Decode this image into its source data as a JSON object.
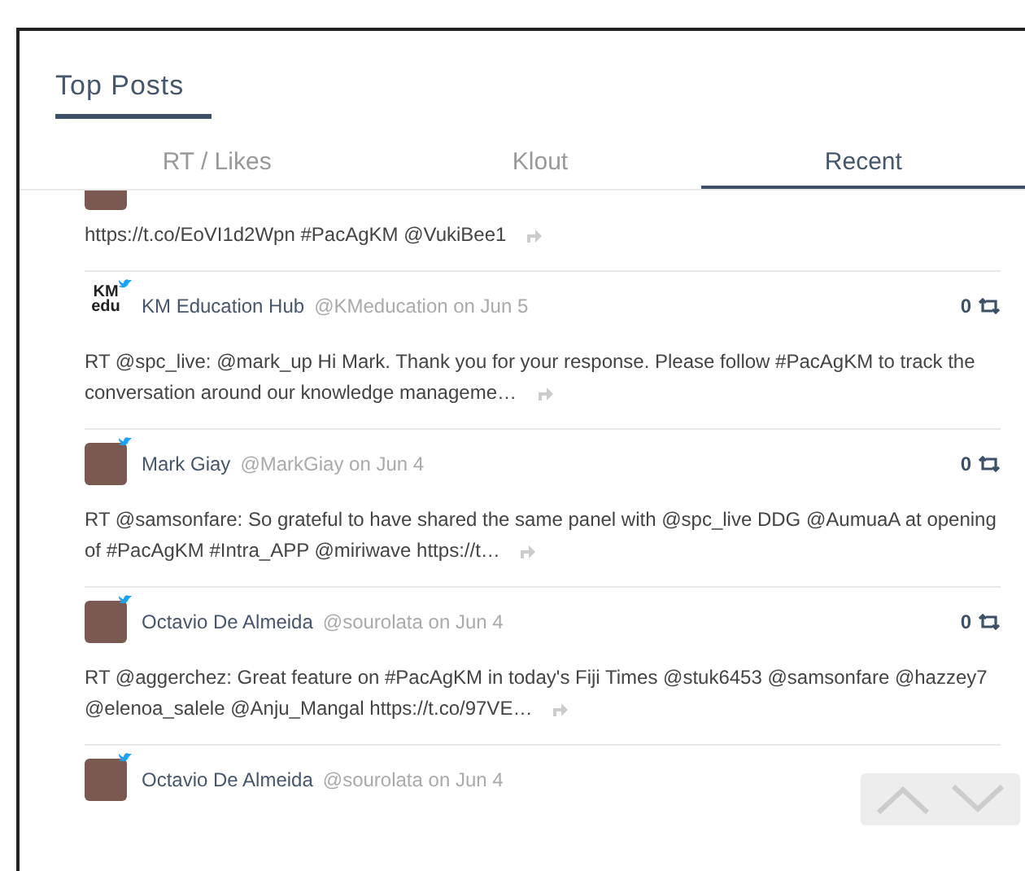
{
  "panel": {
    "title": "Top Posts"
  },
  "tabs": [
    {
      "label": "RT / Likes",
      "selected": false
    },
    {
      "label": "Klout",
      "selected": false
    },
    {
      "label": "Recent",
      "selected": true
    }
  ],
  "posts": [
    {
      "kind": "cut",
      "text": "https://t.co/EoVI1d2Wpn #PacAgKM @VukiBee1"
    },
    {
      "kind": "full",
      "logo_text": "KM edu",
      "author": "KM Education Hub",
      "handle": "@KMeducation",
      "date": "on Jun 5",
      "count": "0",
      "text": "RT @spc_live: @mark_up Hi Mark. Thank you for your response. Please follow #PacAgKM to track the conversation around our knowledge manageme…"
    },
    {
      "kind": "full",
      "author": "Mark Giay",
      "handle": "@MarkGiay",
      "date": "on Jun 4",
      "count": "0",
      "text": "RT @samsonfare: So grateful to have shared the same panel with @spc_live DDG @AumuaA at opening of #PacAgKM #Intra_APP @miriwave https://t…"
    },
    {
      "kind": "full",
      "author": "Octavio De Almeida",
      "handle": "@sourolata",
      "date": "on Jun 4",
      "count": "0",
      "text": "RT @aggerchez: Great feature on #PacAgKM in today's Fiji Times @stuk6453 @samsonfare @hazzey7 @elenoa_salele @Anju_Mangal https://t.co/97VE…"
    },
    {
      "kind": "header",
      "author": "Octavio De Almeida",
      "handle": "@sourolata",
      "date": "on Jun 4"
    }
  ]
}
